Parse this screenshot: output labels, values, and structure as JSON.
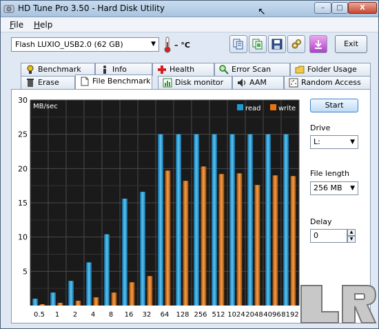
{
  "window": {
    "title": "HD Tune Pro 3.50 - Hard Disk Utility"
  },
  "titlebar_buttons": {
    "minimize": "–",
    "maximize": "□",
    "close": "X"
  },
  "menu": {
    "file_ul": "F",
    "file_rest": "ile",
    "help_ul": "H",
    "help_rest": "elp"
  },
  "toolbar": {
    "drive_label": "Flash   LUXIO_USB2.0 (62 GB)",
    "temperature": "– °C",
    "exit_label": "Exit",
    "icons": [
      "copy-info-icon",
      "copy-screen-icon",
      "save-icon",
      "options-icon",
      "download-icon"
    ]
  },
  "tabs_top": [
    {
      "label": "Benchmark",
      "icon": "benchmark-icon"
    },
    {
      "label": "Info",
      "icon": "info-icon"
    },
    {
      "label": "Health",
      "icon": "health-icon"
    },
    {
      "label": "Error Scan",
      "icon": "error-scan-icon"
    },
    {
      "label": "Folder Usage",
      "icon": "folder-icon"
    }
  ],
  "tabs_bottom": [
    {
      "label": "Erase",
      "icon": "erase-icon"
    },
    {
      "label": "File Benchmark",
      "icon": "file-benchmark-icon",
      "active": true
    },
    {
      "label": "Disk monitor",
      "icon": "disk-monitor-icon"
    },
    {
      "label": "AAM",
      "icon": "aam-icon"
    },
    {
      "label": "Random Access",
      "icon": "random-access-icon"
    }
  ],
  "controls": {
    "start_label": "Start",
    "drive_label": "Drive",
    "drive_value": "L:",
    "file_length_label": "File length",
    "file_length_value": "256 MB",
    "delay_label": "Delay",
    "delay_value": "0"
  },
  "colors": {
    "read": "#1b9ad3",
    "write": "#e8740f",
    "plot_bg": "#1a1a1a",
    "grid": "#4a4a4a"
  },
  "chart_data": {
    "type": "bar",
    "ylabel": "MB/sec",
    "ylim": [
      0,
      30
    ],
    "yticks": [
      5,
      10,
      15,
      20,
      25,
      30
    ],
    "categories": [
      "0.5",
      "1",
      "2",
      "4",
      "8",
      "16",
      "32",
      "64",
      "128",
      "256",
      "512",
      "1024",
      "2048",
      "4096",
      "8192"
    ],
    "series": [
      {
        "name": "read",
        "values": [
          1.0,
          1.9,
          3.6,
          6.3,
          10.4,
          15.6,
          16.6,
          25.0,
          25.0,
          25.0,
          25.0,
          25.0,
          25.0,
          25.0,
          25.0
        ]
      },
      {
        "name": "write",
        "values": [
          0.2,
          0.4,
          0.7,
          1.2,
          1.9,
          3.4,
          4.3,
          19.7,
          18.2,
          20.3,
          19.2,
          19.3,
          17.6,
          19.0,
          18.9
        ]
      }
    ],
    "legend": "top-right",
    "grid": true
  }
}
